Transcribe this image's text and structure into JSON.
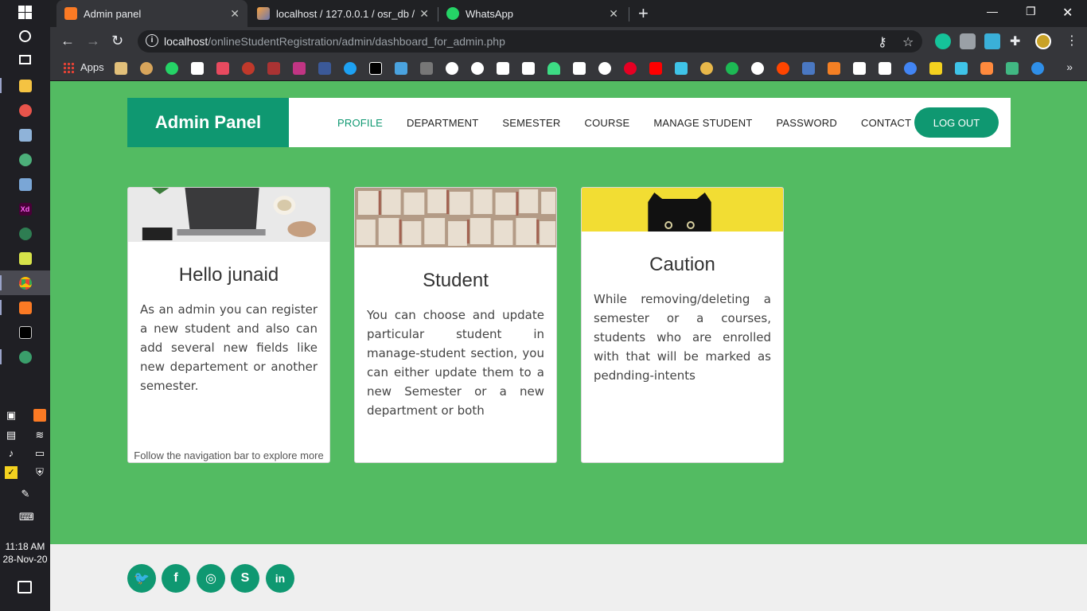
{
  "taskbar": {
    "clock_time": "11:18 AM",
    "clock_date": "28-Nov-20"
  },
  "browser": {
    "tabs": [
      {
        "title": "Admin panel",
        "active": true
      },
      {
        "title": "localhost / 127.0.0.1 / osr_db / ad",
        "active": false
      },
      {
        "title": "WhatsApp",
        "active": false
      }
    ],
    "url_host": "localhost",
    "url_path": "/onlineStudentRegistration/admin/dashboard_for_admin.php",
    "bookmarks_apps_label": "Apps"
  },
  "navbar": {
    "brand": "Admin Panel",
    "links": [
      "PROFILE",
      "DEPARTMENT",
      "SEMESTER",
      "COURSE",
      "MANAGE STUDENT",
      "PASSWORD",
      "CONTACT"
    ],
    "logout": "LOG OUT"
  },
  "cards": [
    {
      "title": "Hello junaid",
      "text": "As an admin you can register a new student and also can add several new fields like new departement or another semester.",
      "footer": "Follow the navigation bar to explore more"
    },
    {
      "title": "Student",
      "text": "You can choose and update particular student in manage-student section, you can either update them to a new Semester or a new department or both"
    },
    {
      "title": "Caution",
      "text": "While removing/deleting a semester or a courses, students who are enrolled with that will be marked as pednding-intents"
    }
  ],
  "footer": {
    "social": [
      "twitter",
      "facebook",
      "instagram",
      "skype",
      "linkedin"
    ],
    "social_glyphs": [
      "🐦",
      "f",
      "◎",
      "S",
      "in"
    ]
  },
  "colors": {
    "accent": "#0f9871",
    "page_bg": "#53bb62"
  }
}
